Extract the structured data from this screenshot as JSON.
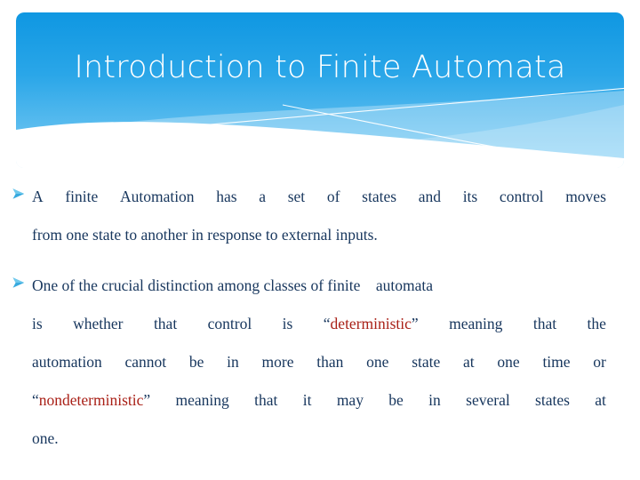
{
  "slide": {
    "title": "Introduction to Finite Automata",
    "title_color": "#FFFFFF",
    "banner_gradient_top": "#159CE4",
    "banner_gradient_bottom": "#72C8F2",
    "body_text_color": "#17365D",
    "highlight_color": "#A92017",
    "bullet_icon": "arrow-bullet-icon",
    "bullet_icon_color": "#33A7DC",
    "background": "#FFFFFF"
  },
  "bullets": [
    {
      "id": "bullet-1",
      "marker": "arrow-bullet-icon",
      "full_text": "A finite Automation has a set of states and its control moves from one state to another in response to external inputs.",
      "lines": [
        {
          "justified": true,
          "words": [
            "A",
            "finite",
            "Automation",
            "has",
            "a",
            "set",
            "of",
            "states",
            "and",
            "its",
            "control",
            "moves"
          ]
        },
        {
          "justified": false,
          "text": "from one state to another in response to external inputs."
        }
      ]
    },
    {
      "id": "bullet-2",
      "marker": "arrow-bullet-icon",
      "full_text": "One of the crucial distinction among classes of finite   automata is whether that control is “deterministic” meaning that the automation cannot be in more than  one state at one time or “nondeterministic” meaning   that it may be in several states at one.",
      "lines": [
        {
          "justified": false,
          "text": "One of the crucial distinction among classes of finite    automata"
        },
        {
          "justified": true,
          "segments": [
            {
              "text": "is",
              "style": "navy"
            },
            {
              "text": "whether",
              "style": "navy"
            },
            {
              "text": "that",
              "style": "navy"
            },
            {
              "text": "control",
              "style": "navy"
            },
            {
              "text": "is",
              "style": "navy"
            },
            {
              "text": "“deterministic”",
              "style": "mixed-quote-red",
              "inner": "deterministic"
            },
            {
              "text": "meaning",
              "style": "navy"
            },
            {
              "text": "that",
              "style": "navy"
            },
            {
              "text": "the",
              "style": "navy"
            }
          ]
        },
        {
          "justified": true,
          "segments": [
            {
              "text": "automation",
              "style": "navy"
            },
            {
              "text": "cannot",
              "style": "navy"
            },
            {
              "text": "be",
              "style": "navy"
            },
            {
              "text": "in",
              "style": "navy"
            },
            {
              "text": "more",
              "style": "navy"
            },
            {
              "text": "than",
              "style": "navy"
            },
            {
              "text": "one",
              "style": "navy"
            },
            {
              "text": "state",
              "style": "navy"
            },
            {
              "text": "at",
              "style": "navy"
            },
            {
              "text": "one",
              "style": "navy"
            },
            {
              "text": "time",
              "style": "navy"
            },
            {
              "text": "or",
              "style": "navy"
            }
          ]
        },
        {
          "justified": true,
          "segments": [
            {
              "text": "“nondeterministic”",
              "style": "mixed-quote-red",
              "inner": "nondeterministic"
            },
            {
              "text": "meaning",
              "style": "navy"
            },
            {
              "text": "that",
              "style": "navy"
            },
            {
              "text": "it",
              "style": "navy"
            },
            {
              "text": "may",
              "style": "navy"
            },
            {
              "text": "be",
              "style": "navy"
            },
            {
              "text": "in",
              "style": "navy"
            },
            {
              "text": "several",
              "style": "navy"
            },
            {
              "text": "states",
              "style": "navy"
            },
            {
              "text": "at",
              "style": "navy"
            }
          ]
        },
        {
          "justified": false,
          "text": "one."
        }
      ]
    }
  ]
}
